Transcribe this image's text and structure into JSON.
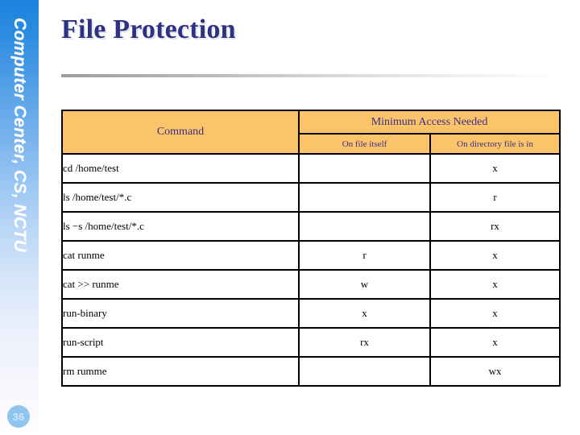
{
  "sidebar": {
    "label": "Computer Center, CS, NCTU",
    "page_number": "36",
    "gradient_top_color": "#1a82dd",
    "gradient_bottom_color": "#ffffff",
    "page_number_bg": "#8fc4ef"
  },
  "slide": {
    "title": "File Protection",
    "title_color": "#2e3282"
  },
  "table": {
    "header_bg": "#fcc46a",
    "header_text_color": "#3b2f82",
    "command_header": "Command",
    "group_header": "Minimum Access Needed",
    "sub_headers": [
      "On file itself",
      "On directory file is in"
    ],
    "rows": [
      {
        "command": "cd /home/test",
        "on_file": "",
        "on_dir": "x"
      },
      {
        "command": "ls /home/test/*.c",
        "on_file": "",
        "on_dir": "r"
      },
      {
        "command": "ls −s /home/test/*.c",
        "on_file": "",
        "on_dir": "rx"
      },
      {
        "command": "cat runme",
        "on_file": "r",
        "on_dir": "x"
      },
      {
        "command": "cat >> runme",
        "on_file": "w",
        "on_dir": "x"
      },
      {
        "command": "run-binary",
        "on_file": "x",
        "on_dir": "x"
      },
      {
        "command": "run-script",
        "on_file": "rx",
        "on_dir": "x"
      },
      {
        "command": "rm rumme",
        "on_file": "",
        "on_dir": "wx"
      }
    ]
  }
}
